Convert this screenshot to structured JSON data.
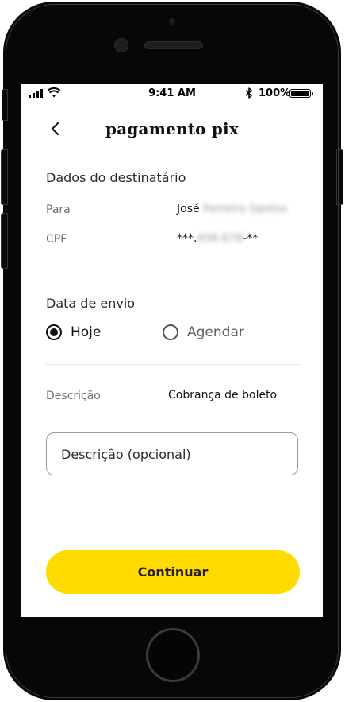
{
  "status_bar": {
    "time": "9:41 AM",
    "battery": "100%"
  },
  "header": {
    "title": "pagamento pix"
  },
  "recipient": {
    "section_title": "Dados do destinatário",
    "name_label": "Para",
    "name_first": "José",
    "name_rest": "Ferreira Santos",
    "cpf_label": "CPF",
    "cpf_prefix": "***.",
    "cpf_hidden": "456.678",
    "cpf_suffix": "-**"
  },
  "send_date": {
    "section_title": "Data de envio",
    "options": [
      {
        "label": "Hoje",
        "selected": true
      },
      {
        "label": "Agendar",
        "selected": false
      }
    ]
  },
  "description": {
    "label": "Descrição",
    "value": "Cobrança de boleto",
    "input_placeholder": "Descrição (opcional)"
  },
  "actions": {
    "continue_label": "Continuar"
  },
  "colors": {
    "accent": "#FFDB00",
    "text": "#111111",
    "muted": "#6F6F6F"
  }
}
